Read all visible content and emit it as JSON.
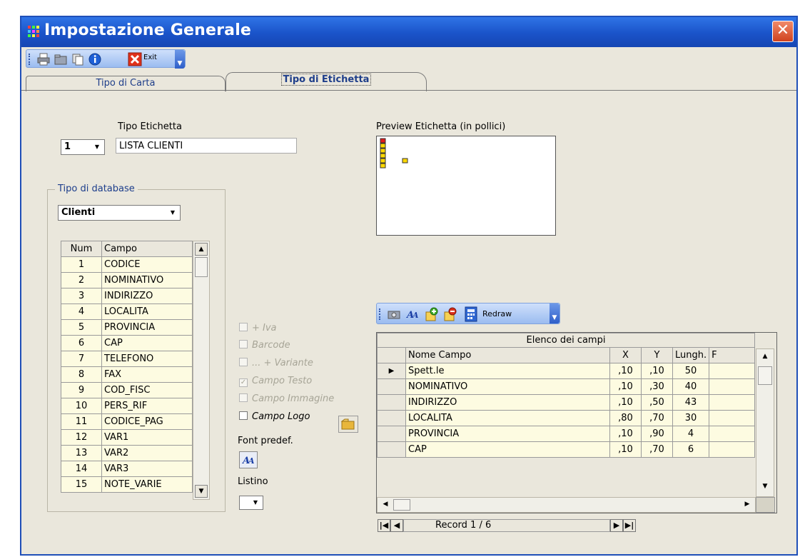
{
  "window": {
    "title": "Impostazione Generale",
    "close_label": "✕"
  },
  "toolbar": {
    "exit_label": "Exit"
  },
  "tabs": [
    {
      "label": "Tipo di Carta",
      "active": false
    },
    {
      "label": "Tipo di Etichetta",
      "active": true
    }
  ],
  "etichetta": {
    "label": "Tipo Etichetta",
    "number": "1",
    "name": "LISTA CLIENTI"
  },
  "database": {
    "group_title": "Tipo di database",
    "selected": "Clienti",
    "columns": [
      "Num",
      "Campo"
    ],
    "rows": [
      {
        "num": "1",
        "campo": "CODICE"
      },
      {
        "num": "2",
        "campo": "NOMINATIVO"
      },
      {
        "num": "3",
        "campo": "INDIRIZZO"
      },
      {
        "num": "4",
        "campo": "LOCALITA"
      },
      {
        "num": "5",
        "campo": "PROVINCIA"
      },
      {
        "num": "6",
        "campo": "CAP"
      },
      {
        "num": "7",
        "campo": "TELEFONO"
      },
      {
        "num": "8",
        "campo": "FAX"
      },
      {
        "num": "9",
        "campo": "COD_FISC"
      },
      {
        "num": "10",
        "campo": "PERS_RIF"
      },
      {
        "num": "11",
        "campo": "CODICE_PAG"
      },
      {
        "num": "12",
        "campo": "VAR1"
      },
      {
        "num": "13",
        "campo": "VAR2"
      },
      {
        "num": "14",
        "campo": "VAR3"
      },
      {
        "num": "15",
        "campo": "NOTE_VARIE"
      }
    ]
  },
  "options": {
    "iva": "+ Iva",
    "barcode": "Barcode",
    "variante": "... + Variante",
    "campo_testo": "Campo Testo",
    "campo_immagine": "Campo Immagine",
    "campo_logo": "Campo Logo",
    "font_label": "Font predef.",
    "listino_label": "Listino"
  },
  "preview": {
    "label": "Preview Etichetta (in pollici)"
  },
  "grid_toolbar": {
    "redraw_label": "Redraw"
  },
  "fields": {
    "caption": "Elenco dei campi",
    "columns": [
      "Nome Campo",
      "X",
      "Y",
      "Lungh.",
      "F"
    ],
    "rows": [
      {
        "name": "Spett.le",
        "x": ",10",
        "y": ",10",
        "len": "50"
      },
      {
        "name": "NOMINATIVO",
        "x": ",10",
        "y": ",30",
        "len": "40"
      },
      {
        "name": "INDIRIZZO",
        "x": ",10",
        "y": ",50",
        "len": "43"
      },
      {
        "name": "LOCALITA",
        "x": ",80",
        "y": ",70",
        "len": "30"
      },
      {
        "name": "PROVINCIA",
        "x": ",10",
        "y": ",90",
        "len": "4"
      },
      {
        "name": "CAP",
        "x": ",10",
        "y": ",70",
        "len": "6"
      }
    ]
  },
  "navigator": {
    "record_text": "Record 1 / 6"
  },
  "colors": {
    "title_blue": "#1a53c9",
    "panel_bg": "#eae7dc",
    "grid_row_bg": "#fdfbe1"
  }
}
